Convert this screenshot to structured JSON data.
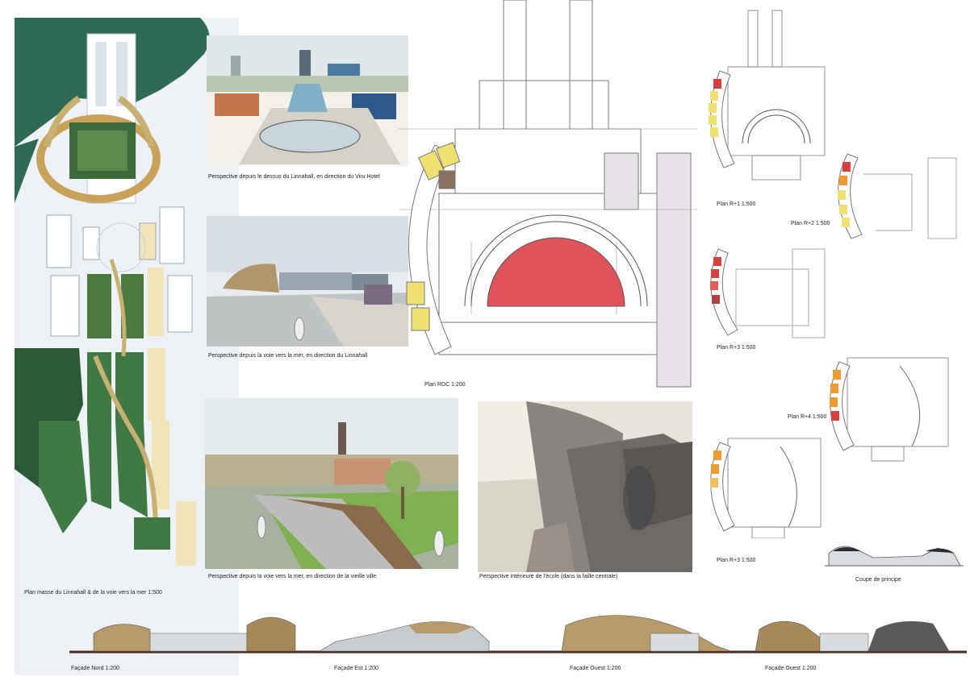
{
  "captions": {
    "persp1": "Perspective depuis le dessus du Linnahall, en direction du Viru Hotel",
    "persp2": "Perspective depuis la voie vers la mer, en direction du Linnahall",
    "persp3": "Perspective depuis la voie vers la mer, en direction de la vieille ville",
    "persp4": "Perspective intérieure de l'école (dans la faille centrale)",
    "plan_masse": "Plan masse du Linnahall & de la voie vers la mer 1:500",
    "plan_rdc": "Plan RDC 1:200",
    "plan_r1": "Plan R+1 1:500",
    "plan_r2": "Plan R+2 1:500",
    "plan_r3a": "Plan R+3 1:500",
    "plan_r4": "Plan R+4 1:500",
    "plan_r3b": "Plan R+3 1:500",
    "coupe": "Coupe de principe",
    "facade_nord": "Façade Nord 1:200",
    "facade_est": "Façade Est 1:200",
    "facade_ouest1": "Façade Ouest 1:200",
    "facade_ouest2": "Façade Ouest 1:200"
  },
  "colors": {
    "sea": "#2f6a55",
    "park": "#3f7a45",
    "theatre": "#e0535a",
    "yellow": "#f0e070",
    "orange": "#ef9a30",
    "red": "#d84040",
    "brown": "#8a5a40",
    "wood": "#a89060"
  }
}
